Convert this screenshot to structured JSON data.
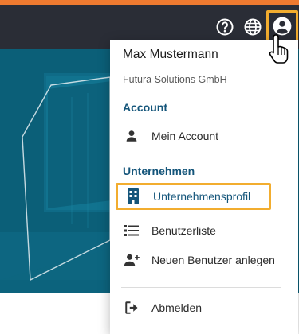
{
  "topbar": {
    "help_icon": "help-circle-icon",
    "language_icon": "globe-icon",
    "user_icon": "account-circle-icon"
  },
  "menu": {
    "user_name": "Max Mustermann",
    "company_name": "Futura Solutions GmbH",
    "account_heading": "Account",
    "company_heading": "Unternehmen",
    "items": [
      {
        "label": "Mein Account",
        "icon": "person-icon"
      },
      {
        "label": "Unternehmensprofil",
        "icon": "building-icon"
      },
      {
        "label": "Benutzerliste",
        "icon": "list-icon"
      },
      {
        "label": "Neuen Benutzer anlegen",
        "icon": "person-add-icon"
      },
      {
        "label": "Abmelden",
        "icon": "logout-icon"
      }
    ]
  },
  "colors": {
    "accent_orange": "#ee7a30",
    "highlight_yellow": "#f2ad2f",
    "topbar": "#2a2d36",
    "hero_teal": "#0b5f78",
    "heading_blue": "#14557a"
  }
}
